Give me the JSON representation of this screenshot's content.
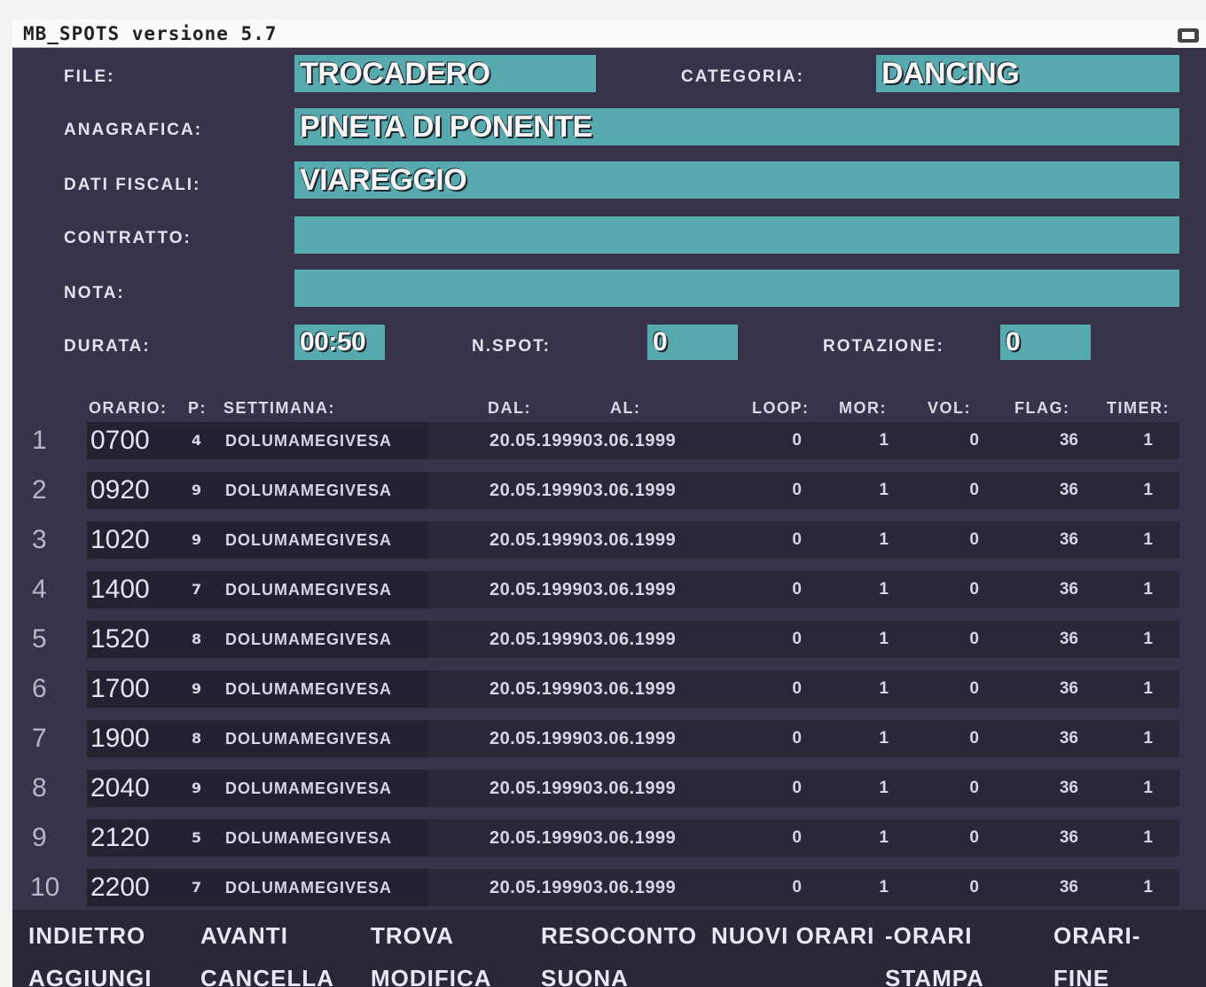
{
  "window": {
    "title": "MB_SPOTS  versione 5.7"
  },
  "form": {
    "file_label": "FILE:",
    "file_value": "TROCADERO",
    "categoria_label": "CATEGORIA:",
    "categoria_value": "DANCING",
    "anagrafica_label": "ANAGRAFICA:",
    "anagrafica_value": "PINETA DI PONENTE",
    "dati_fiscali_label": "DATI FISCALI:",
    "dati_fiscali_value": "VIAREGGIO",
    "contratto_label": "CONTRATTO:",
    "contratto_value": "",
    "nota_label": "NOTA:",
    "nota_value": "",
    "durata_label": "DURATA:",
    "durata_value": "00:50",
    "nspot_label": "N.SPOT:",
    "nspot_value": "0",
    "rotazione_label": "ROTAZIONE:",
    "rotazione_value": "0"
  },
  "table": {
    "headers": {
      "orario": "ORARIO:",
      "p": "P:",
      "settimana": "SETTIMANA:",
      "dal": "DAL:",
      "al": "AL:",
      "loop": "LOOP:",
      "mor": "MOR:",
      "vol": "VOL:",
      "flag": "FLAG:",
      "timer": "TIMER:"
    },
    "rows": [
      {
        "n": "1",
        "orario": "0700",
        "p": "4",
        "settimana": "DOLUMAMEGIVESA",
        "dal_al": "20.05.199903.06.1999",
        "loop": "0",
        "mor": "1",
        "vol": "0",
        "flag": "36",
        "timer": "1"
      },
      {
        "n": "2",
        "orario": "0920",
        "p": "9",
        "settimana": "DOLUMAMEGIVESA",
        "dal_al": "20.05.199903.06.1999",
        "loop": "0",
        "mor": "1",
        "vol": "0",
        "flag": "36",
        "timer": "1"
      },
      {
        "n": "3",
        "orario": "1020",
        "p": "9",
        "settimana": "DOLUMAMEGIVESA",
        "dal_al": "20.05.199903.06.1999",
        "loop": "0",
        "mor": "1",
        "vol": "0",
        "flag": "36",
        "timer": "1"
      },
      {
        "n": "4",
        "orario": "1400",
        "p": "7",
        "settimana": "DOLUMAMEGIVESA",
        "dal_al": "20.05.199903.06.1999",
        "loop": "0",
        "mor": "1",
        "vol": "0",
        "flag": "36",
        "timer": "1"
      },
      {
        "n": "5",
        "orario": "1520",
        "p": "8",
        "settimana": "DOLUMAMEGIVESA",
        "dal_al": "20.05.199903.06.1999",
        "loop": "0",
        "mor": "1",
        "vol": "0",
        "flag": "36",
        "timer": "1"
      },
      {
        "n": "6",
        "orario": "1700",
        "p": "9",
        "settimana": "DOLUMAMEGIVESA",
        "dal_al": "20.05.199903.06.1999",
        "loop": "0",
        "mor": "1",
        "vol": "0",
        "flag": "36",
        "timer": "1"
      },
      {
        "n": "7",
        "orario": "1900",
        "p": "8",
        "settimana": "DOLUMAMEGIVESA",
        "dal_al": "20.05.199903.06.1999",
        "loop": "0",
        "mor": "1",
        "vol": "0",
        "flag": "36",
        "timer": "1"
      },
      {
        "n": "8",
        "orario": "2040",
        "p": "9",
        "settimana": "DOLUMAMEGIVESA",
        "dal_al": "20.05.199903.06.1999",
        "loop": "0",
        "mor": "1",
        "vol": "0",
        "flag": "36",
        "timer": "1"
      },
      {
        "n": "9",
        "orario": "2120",
        "p": "5",
        "settimana": "DOLUMAMEGIVESA",
        "dal_al": "20.05.199903.06.1999",
        "loop": "0",
        "mor": "1",
        "vol": "0",
        "flag": "36",
        "timer": "1"
      },
      {
        "n": "10",
        "orario": "2200",
        "p": "7",
        "settimana": "DOLUMAMEGIVESA",
        "dal_al": "20.05.199903.06.1999",
        "loop": "0",
        "mor": "1",
        "vol": "0",
        "flag": "36",
        "timer": "1"
      }
    ]
  },
  "buttons": {
    "indietro": "INDIETRO",
    "avanti": "AVANTI",
    "trova": "TROVA",
    "resoconto": "RESOCONTO",
    "nuovi_orari": "NUOVI ORARI",
    "meno_orari": "-ORARI",
    "orari_meno": "ORARI-",
    "aggiungi": "AGGIUNGI",
    "cancella": "CANCELLA",
    "modifica": "MODIFICA",
    "suona": "SUONA",
    "stampa": "STAMPA",
    "fine": "FINE"
  },
  "colors": {
    "background": "#37334a",
    "field": "#56a9ad",
    "row_band": "#2a2737"
  }
}
